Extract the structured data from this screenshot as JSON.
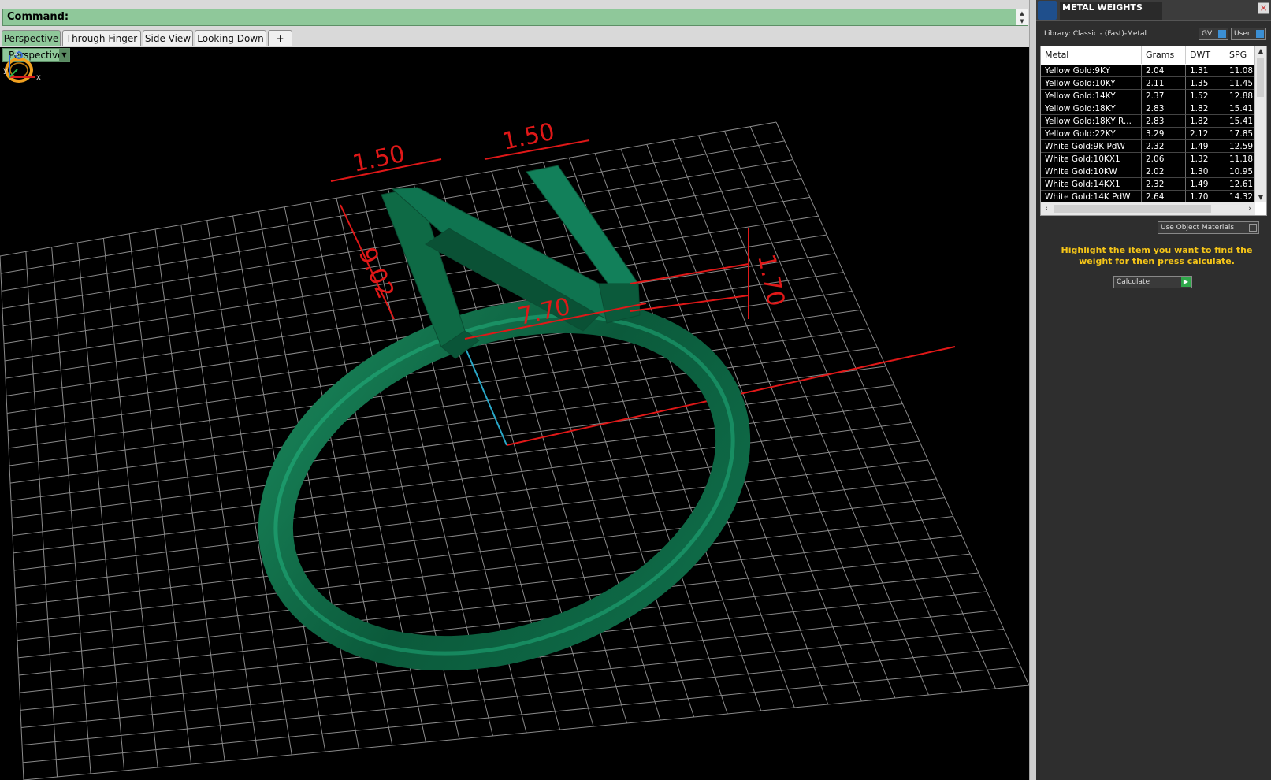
{
  "command": {
    "label": "Command:"
  },
  "tabs": [
    {
      "label": "Perspective",
      "active": true
    },
    {
      "label": "Through Finger",
      "active": false
    },
    {
      "label": "Side View",
      "active": false
    },
    {
      "label": "Looking Down",
      "active": false
    },
    {
      "label": "+",
      "active": false
    }
  ],
  "viewport": {
    "view_dropdown": "Perspective",
    "dimensions": [
      "1.50",
      "1.50",
      "9.02",
      "7.70",
      "1.70"
    ],
    "axis": {
      "x": "x",
      "y": "y",
      "z": "z"
    },
    "colors": {
      "model": "#0f6e4a",
      "dimension": "#e01818",
      "grid": "#9a9a9a",
      "background": "#000000"
    }
  },
  "panel": {
    "title": "METAL WEIGHTS",
    "library": "Library: Classic - (Fast)-Metal",
    "toggles": [
      {
        "label": "GV"
      },
      {
        "label": "User"
      }
    ],
    "table": {
      "columns": [
        "Metal",
        "Grams",
        "DWT",
        "SPG"
      ],
      "rows": [
        [
          "Yellow Gold:9KY",
          "2.04",
          "1.31",
          "11.08"
        ],
        [
          "Yellow Gold:10KY",
          "2.11",
          "1.35",
          "11.45"
        ],
        [
          "Yellow Gold:14KY",
          "2.37",
          "1.52",
          "12.88"
        ],
        [
          "Yellow Gold:18KY",
          "2.83",
          "1.82",
          "15.41"
        ],
        [
          "Yellow Gold:18KY R...",
          "2.83",
          "1.82",
          "15.41"
        ],
        [
          "Yellow Gold:22KY",
          "3.29",
          "2.12",
          "17.85"
        ],
        [
          "White Gold:9K PdW",
          "2.32",
          "1.49",
          "12.59"
        ],
        [
          "White Gold:10KX1",
          "2.06",
          "1.32",
          "11.18"
        ],
        [
          "White Gold:10KW",
          "2.02",
          "1.30",
          "10.95"
        ],
        [
          "White Gold:14KX1",
          "2.32",
          "1.49",
          "12.61"
        ],
        [
          "White Gold:14K PdW",
          "2.64",
          "1.70",
          "14.32"
        ]
      ]
    },
    "use_object_materials": "Use Object Materials",
    "hint": "Highlight the item you want to find the weight for then press calculate.",
    "calculate": "Calculate"
  }
}
